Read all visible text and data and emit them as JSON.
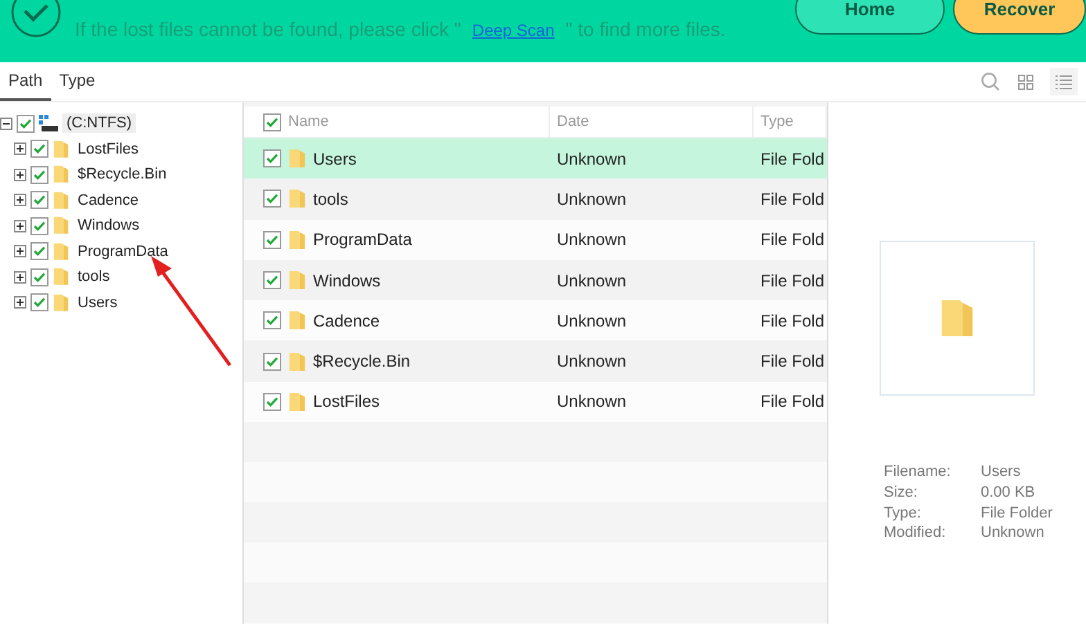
{
  "header": {
    "hint_before": "If the lost files cannot be found, please click \"",
    "hint_link": "Deep Scan",
    "hint_after": "\" to find more files.",
    "buttons": [
      {
        "label": "Home",
        "kind": "secondary"
      },
      {
        "label": "Recover",
        "kind": "primary"
      }
    ]
  },
  "tabs": [
    {
      "label": "Path",
      "selected": true
    },
    {
      "label": "Type",
      "selected": false
    }
  ],
  "view_modes": [
    {
      "kind": "grid",
      "selected": false
    },
    {
      "kind": "list",
      "selected": true
    }
  ],
  "tree": {
    "label": "(C:NTFS)",
    "checked": true,
    "expanded": true,
    "selected": true,
    "children": [
      {
        "label": "LostFiles",
        "checked": true,
        "expanded": false
      },
      {
        "label": "$Recycle.Bin",
        "checked": true,
        "expanded": false
      },
      {
        "label": "Cadence",
        "checked": true,
        "expanded": false
      },
      {
        "label": "Windows",
        "checked": true,
        "expanded": false
      },
      {
        "label": "ProgramData",
        "checked": true,
        "expanded": false
      },
      {
        "label": "tools",
        "checked": true,
        "expanded": false
      },
      {
        "label": "Users",
        "checked": true,
        "expanded": false
      }
    ]
  },
  "table": {
    "all_checked": true,
    "columns": [
      "Name",
      "Date",
      "Type"
    ],
    "rows": [
      {
        "name": "Users",
        "date": "Unknown",
        "type": "File Fold",
        "checked": true,
        "selected": true
      },
      {
        "name": "tools",
        "date": "Unknown",
        "type": "File Fold",
        "checked": true,
        "selected": false
      },
      {
        "name": "ProgramData",
        "date": "Unknown",
        "type": "File Fold",
        "checked": true,
        "selected": false
      },
      {
        "name": "Windows",
        "date": "Unknown",
        "type": "File Fold",
        "checked": true,
        "selected": false
      },
      {
        "name": "Cadence",
        "date": "Unknown",
        "type": "File Fold",
        "checked": true,
        "selected": false
      },
      {
        "name": "$Recycle.Bin",
        "date": "Unknown",
        "type": "File Fold",
        "checked": true,
        "selected": false
      },
      {
        "name": "LostFiles",
        "date": "Unknown",
        "type": "File Fold",
        "checked": true,
        "selected": false
      }
    ]
  },
  "preview": {
    "details": [
      {
        "label": "Filename:",
        "value": "Users"
      },
      {
        "label": "Size:",
        "value": "0.00 KB"
      },
      {
        "label": "Type:",
        "value": "File Folder"
      },
      {
        "label": "Modified:",
        "value": "Unknown"
      }
    ]
  }
}
